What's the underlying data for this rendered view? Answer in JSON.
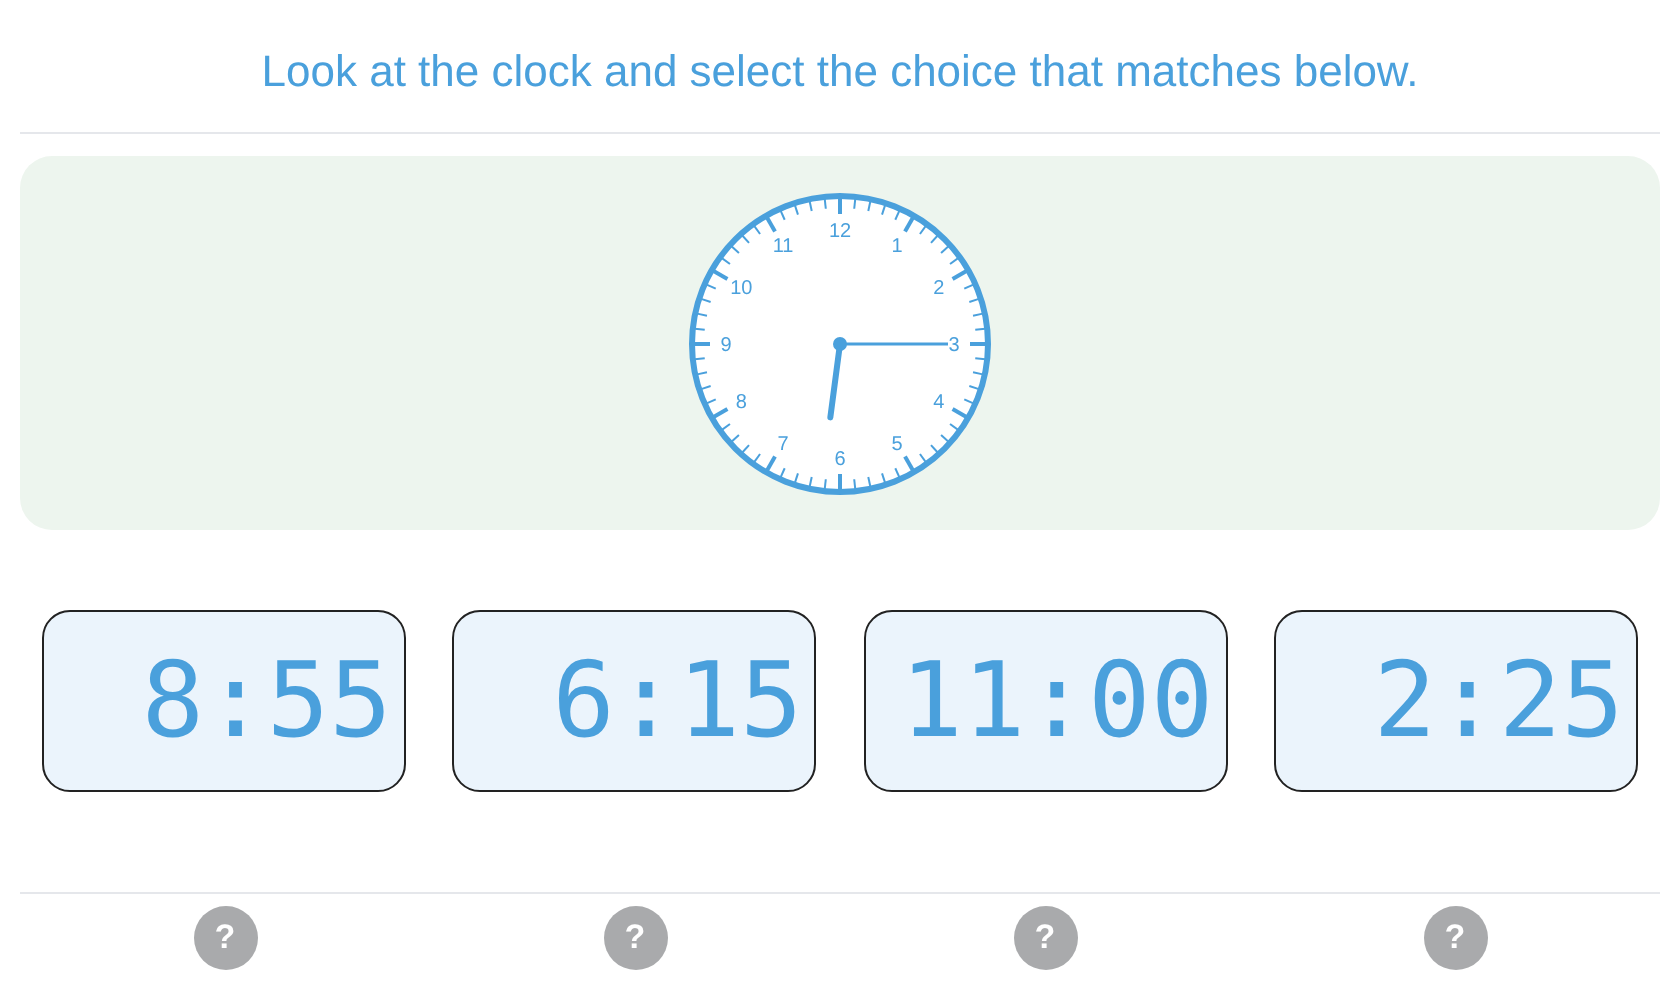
{
  "instruction": "Look at the clock and select the choice that matches below.",
  "clock": {
    "numbers": [
      "12",
      "1",
      "2",
      "3",
      "4",
      "5",
      "6",
      "7",
      "8",
      "9",
      "10",
      "11"
    ]
  },
  "choices": [
    {
      "label": "8:55",
      "selected": false
    },
    {
      "label": "6:15",
      "selected": false
    },
    {
      "label": "11:00",
      "selected": false
    },
    {
      "label": "2:25",
      "selected": false
    }
  ],
  "help_buttons": [
    "?",
    "?",
    "?",
    "?"
  ]
}
